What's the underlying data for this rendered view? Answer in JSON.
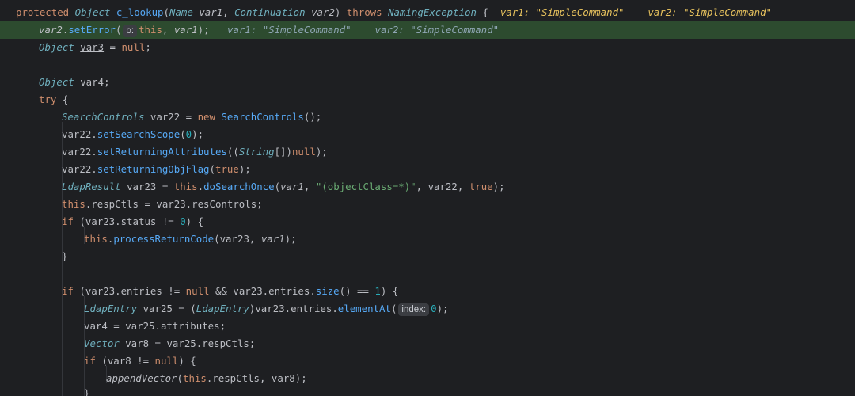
{
  "editor": {
    "lines": {
      "l1": {
        "kw1": "protected",
        "type1": "Object",
        "name": "c_lookup",
        "p1": "(",
        "type2": "Name",
        "arg1": "var1",
        "comma": ", ",
        "type3": "Continuation",
        "arg2": "var2",
        "p2": ") ",
        "kw2": "throws",
        "type4": "NamingException",
        "brace": " {",
        "dbg1": "var1: \"SimpleCommand\"",
        "dbg2": "var2: \"SimpleCommand\""
      },
      "l2": {
        "var": "var2",
        "dot": ".",
        "call": "setError",
        "p1": "(",
        "hint": "o:",
        "kw": "this",
        "comma": ", ",
        "arg": "var1",
        "p2": ");",
        "dbg1": "var1: \"SimpleCommand\"",
        "dbg2": "var2: \"SimpleCommand\""
      },
      "l3": {
        "type": "Object",
        "var": "var3",
        "eq": " = ",
        "kw": "null",
        "end": ";"
      },
      "l5": {
        "type": "Object",
        "rest": " var4;"
      },
      "l6": {
        "kw": "try",
        "brace": " {"
      },
      "l7": {
        "type": "SearchControls",
        "mid": " var22 = ",
        "kw": "new",
        "call": "SearchControls",
        "end": "();"
      },
      "l8": {
        "var": "var22.",
        "call": "setSearchScope",
        "p1": "(",
        "num": "0",
        "p2": ");"
      },
      "l9": {
        "var": "var22.",
        "call": "setReturningAttributes",
        "p1": "((",
        "type": "String",
        "p2": "[])",
        "kw": "null",
        "p3": ");"
      },
      "l10": {
        "var": "var22.",
        "call": "setReturningObjFlag",
        "p1": "(",
        "kw": "true",
        "p2": ");"
      },
      "l11": {
        "type": "LdapResult",
        "mid": " var23 = ",
        "kw": "this",
        "dot": ".",
        "call": "doSearchOnce",
        "p1": "(",
        "arg": "var1",
        "comma": ", ",
        "str": "\"(objectClass=*)\"",
        "mid2": ", var22, ",
        "kw2": "true",
        "p2": ");"
      },
      "l12": {
        "kw": "this",
        "rest": ".respCtls = var23.resControls;"
      },
      "l13": {
        "kw": "if",
        "mid": " (var23.status != ",
        "num": "0",
        "end": ") {"
      },
      "l14": {
        "kw": "this",
        "dot": ".",
        "call": "processReturnCode",
        "p1": "(var23, ",
        "arg": "var1",
        "p2": ");"
      },
      "l15": {
        "brace": "}"
      },
      "l17": {
        "kw": "if",
        "mid": " (var23.entries != ",
        "kw2": "null",
        "mid2": " && var23.entries.",
        "call": "size",
        "mid3": "() == ",
        "num": "1",
        "end": ") {"
      },
      "l18": {
        "type": "LdapEntry",
        "mid": " var25 = (",
        "type2": "LdapEntry",
        "mid2": ")var23.entries.",
        "call": "elementAt",
        "p1": "(",
        "hint": "index:",
        "num": "0",
        "p2": ");"
      },
      "l19": {
        "rest": "var4 = var25.attributes;"
      },
      "l20": {
        "type": "Vector",
        "rest": " var8 = var25.respCtls;"
      },
      "l21": {
        "kw": "if",
        "mid": " (var8 != ",
        "kw2": "null",
        "end": ") {"
      },
      "l22": {
        "call": "appendVector",
        "p1": "(",
        "kw": "this",
        "rest": ".respCtls, var8);"
      },
      "l23": {
        "brace": "}"
      }
    }
  }
}
